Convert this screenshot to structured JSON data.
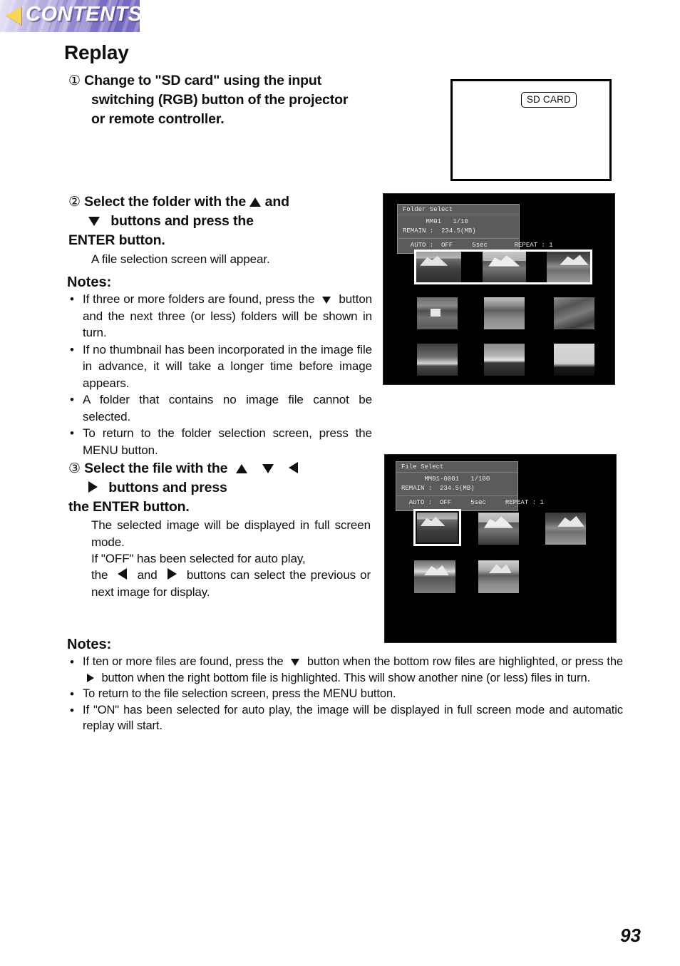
{
  "banner": {
    "label": "CONTENTS",
    "accent_color": "#7e74c4",
    "arrow_color": "#f7d558",
    "arrow_icon": "back-triangle-icon"
  },
  "page": {
    "title": "Replay",
    "number": "93"
  },
  "steps": [
    {
      "marker": "①",
      "line1": "Change to \"SD card\" using the input",
      "line2": "switching (RGB) button of the projector",
      "line3": "or remote controller."
    },
    {
      "marker": "②",
      "lead": "Select the folder with the",
      "mid": "and",
      "tail": "buttons and press the",
      "line3": "ENTER button.",
      "sub": "A file selection screen will appear."
    },
    {
      "marker": "③",
      "lead": "Select the file with the",
      "tail": "buttons and press",
      "line3": "the ENTER button.",
      "sub_line1": "The selected image will be displayed in full screen mode.",
      "sub_line2": "If \"OFF\" has been selected for auto play,",
      "sub_line3_a": "the",
      "sub_line3_b": "and",
      "sub_line3_c": "buttons can select the previous or next image for display."
    }
  ],
  "notes_folder": {
    "heading": "Notes:",
    "items": [
      {
        "part_a": "If three or more folders are found, press the",
        "part_b": "button and the next three (or less) folders will be shown in turn."
      },
      {
        "text": "If no thumbnail has been incorporated in the image file in advance, it will take a longer time before image appears."
      },
      {
        "text": "A folder that contains no image file cannot be selected."
      },
      {
        "text": "To return to the folder selection screen, press the MENU button."
      }
    ],
    "bullet": "•"
  },
  "notes_file": {
    "heading": "Notes:",
    "items": [
      {
        "part_a": "If ten or more files are found, press the",
        "part_b": "button when the bottom row files are highlighted, or press the",
        "part_c": "button when the right bottom file is highlighted. This will show another nine (or less) files in turn."
      },
      {
        "text": "To return to the file selection screen, press the MENU button."
      },
      {
        "text": "If \"ON\" has been selected for auto play, the image will be displayed in full screen mode and automatic replay will start."
      }
    ],
    "bullet": "•"
  },
  "sd_figure": {
    "chip_label": "SD CARD"
  },
  "folder_select_screen": {
    "panel_title": "Folder Select",
    "id_line": "      MM01   1/10",
    "remain_line": "REMAIN :  234.5(MB)",
    "bottom_line": "  AUTO :  OFF     5sec       REPEAT : 1",
    "selected_row": 1,
    "thumbnails": [
      [
        "mtn1",
        "blank",
        "mtn2",
        "blank",
        "mtn3"
      ],
      [
        "house",
        "field",
        "bush"
      ],
      [
        "sunset1",
        "sunset2",
        "trees"
      ]
    ]
  },
  "file_select_screen": {
    "panel_title": "File Select",
    "id_line": "      MM01-0001   1/100",
    "remain_line": "REMAIN :  234.5(MB)",
    "bottom_line": "  AUTO :  OFF     5sec     REPEAT : 1",
    "selected_index": 0,
    "thumbnails": [
      "mtn1",
      "mtn2",
      "mtn3",
      "valley",
      "village"
    ]
  }
}
